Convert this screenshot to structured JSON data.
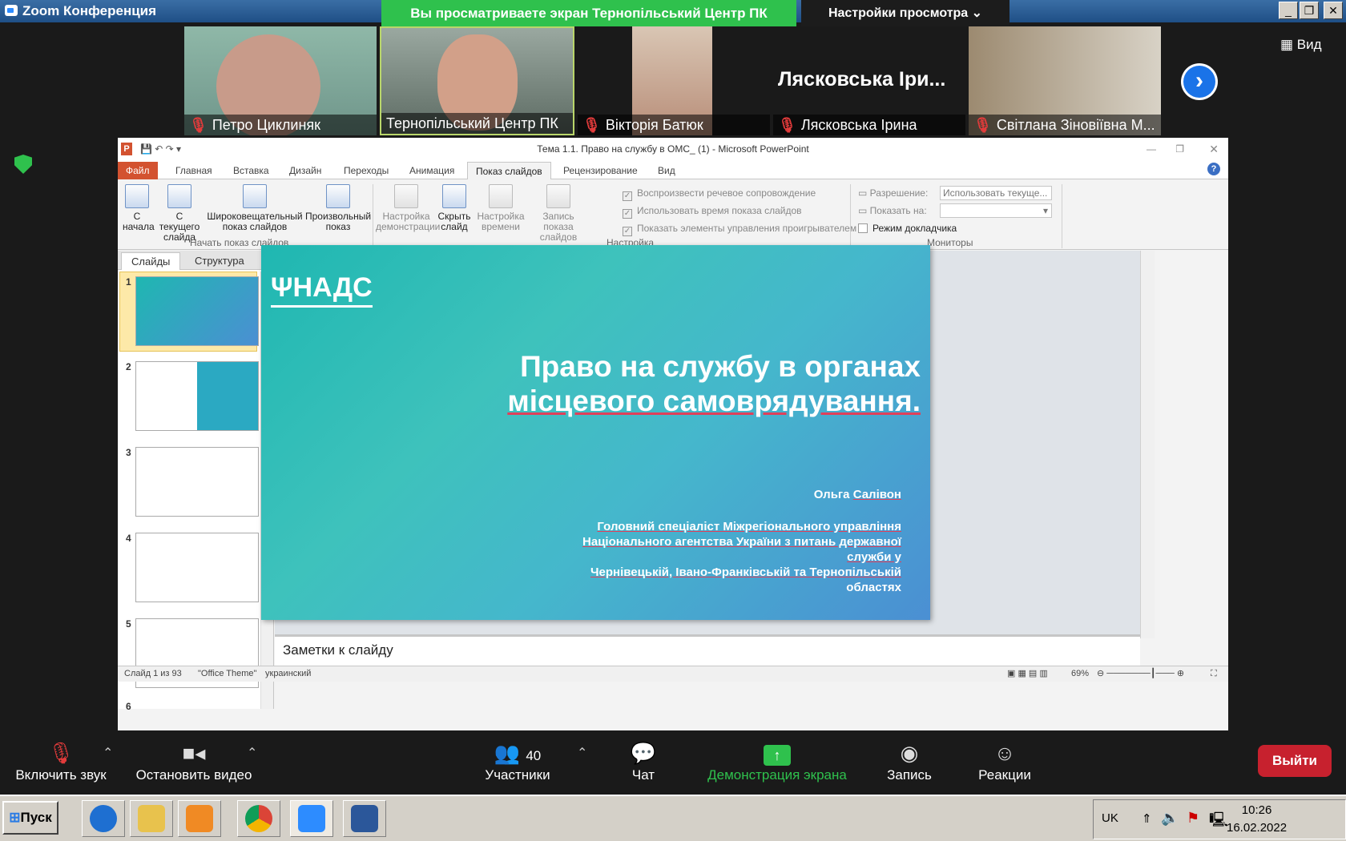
{
  "window": {
    "title": "Zoom Конференция"
  },
  "share": {
    "banner": "Вы просматриваете экран Тернопільський Центр ПК",
    "view_options": "Настройки просмотра"
  },
  "participants": [
    {
      "name": "Петро Циклиняк"
    },
    {
      "name": "Тернопільський Центр ПК"
    },
    {
      "name": "Вікторія Батюк"
    },
    {
      "name": "Лясковська Ірина",
      "avatar_text": "Лясковська Іри..."
    },
    {
      "name": "Світлана Зіновіївна М..."
    }
  ],
  "view_button": "Вид",
  "ppt": {
    "title": "Тема 1.1. Право на службу в ОМС_ (1) - Microsoft PowerPoint",
    "tabs": [
      "Файл",
      "Главная",
      "Вставка",
      "Дизайн",
      "Переходы",
      "Анимация",
      "Показ слайдов",
      "Рецензирование",
      "Вид"
    ],
    "ribbon": {
      "from_start": "С начала",
      "from_current": "С текущего слайда",
      "broadcast": "Широковещательный показ слайдов",
      "custom": "Произвольный показ",
      "group_start": "Начать показ слайдов",
      "setup": "Настройка демонстрации",
      "hide": "Скрыть слайд",
      "timing": "Настройка времени",
      "record": "Запись показа слайдов",
      "play_narration": "Воспроизвести речевое сопровождение",
      "use_timings": "Использовать время показа слайдов",
      "show_controls": "Показать элементы управления проигрывателем",
      "group_setup": "Настройка",
      "resolution_label": "Разрешение:",
      "resolution_value": "Использовать текуще...",
      "show_on_label": "Показать на:",
      "presenter_view": "Режим докладчика",
      "group_monitors": "Мониторы"
    },
    "pane_tabs": [
      "Слайды",
      "Структура"
    ],
    "thumb_numbers": [
      "1",
      "2",
      "3",
      "4",
      "5",
      "6"
    ],
    "slide": {
      "logo": "НАДС",
      "title_line1": "Право на службу в органах",
      "title_line2": "місцевого самоврядування.",
      "author_first": "Ольга",
      "author_last": "Салівон",
      "role1": "Головний спеціаліст Міжрегіонального управління",
      "role2": "Національного агентства України з питань державної",
      "role3": "служби у",
      "role4": "Чернівецькій, Івано-Франківській та Тернопільській",
      "role5": "областях"
    },
    "notes_placeholder": "Заметки к слайду",
    "status": {
      "slide": "Слайд 1 из 93",
      "theme": "\"Office Theme\"",
      "lang": "украинский",
      "zoom": "69%"
    }
  },
  "toolbar": {
    "unmute": "Включить звук",
    "start_video": "Остановить видео",
    "participants": "Участники",
    "participants_count": "40",
    "chat": "Чат",
    "share": "Демонстрация экрана",
    "record": "Запись",
    "reactions": "Реакции",
    "leave": "Выйти"
  },
  "taskbar": {
    "start": "Пуск",
    "lang": "UK",
    "time": "10:26",
    "date": "16.02.2022"
  }
}
